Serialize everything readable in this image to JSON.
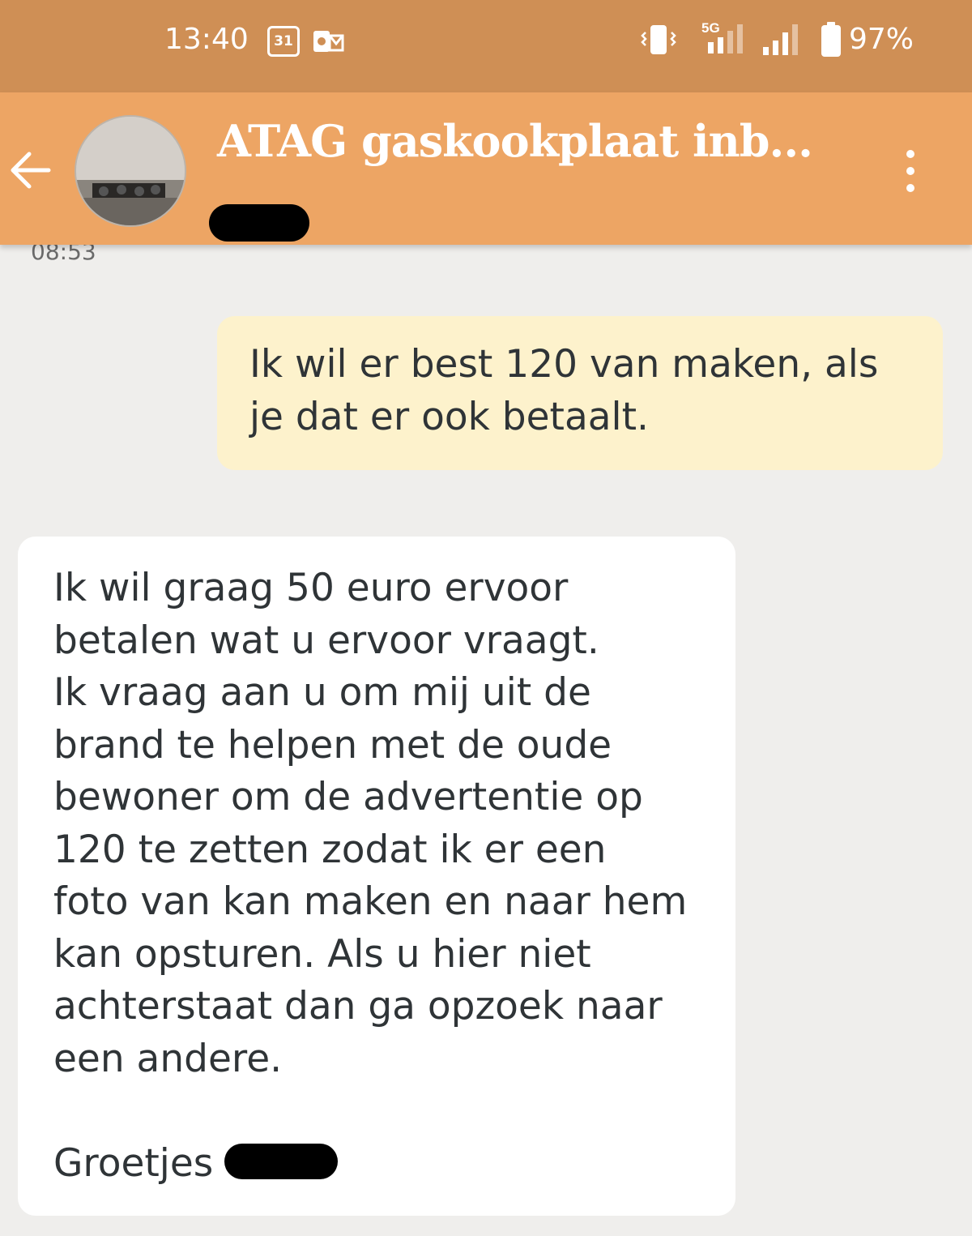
{
  "status_bar": {
    "time": "13:40",
    "calendar_day": "31",
    "network_type": "5G",
    "battery": "97%"
  },
  "header": {
    "title": "ATAG gaskookplaat inb...",
    "subtitle_redacted": true
  },
  "chat": {
    "timestamp": "08:53",
    "messages": [
      {
        "direction": "outgoing",
        "lines": [
          "Ik wil er best 120 van maken, als",
          "je dat er ook betaalt."
        ]
      },
      {
        "direction": "incoming",
        "lines": [
          "Ik wil graag 50 euro ervoor",
          "betalen wat u ervoor vraagt.",
          "Ik vraag aan u om mij uit de",
          "brand te helpen met de oude",
          "bewoner om de advertentie op",
          "120 te zetten zodat ik er een",
          "foto van kan maken en naar hem",
          "kan opsturen. Als u hier niet",
          "achterstaat dan ga opzoek naar",
          "een andere.",
          "",
          "Groetjes"
        ]
      }
    ]
  },
  "colors": {
    "status_bar": "#cf8f55",
    "header": "#eda564",
    "outgoing_bubble": "#fdf2cc",
    "incoming_bubble": "#ffffff",
    "background": "#efeeec"
  },
  "icons": [
    "calendar-icon",
    "outlook-icon",
    "vibrate-icon",
    "signal-5g-icon",
    "signal-icon",
    "battery-icon",
    "back-arrow-icon",
    "more-vert-icon"
  ]
}
